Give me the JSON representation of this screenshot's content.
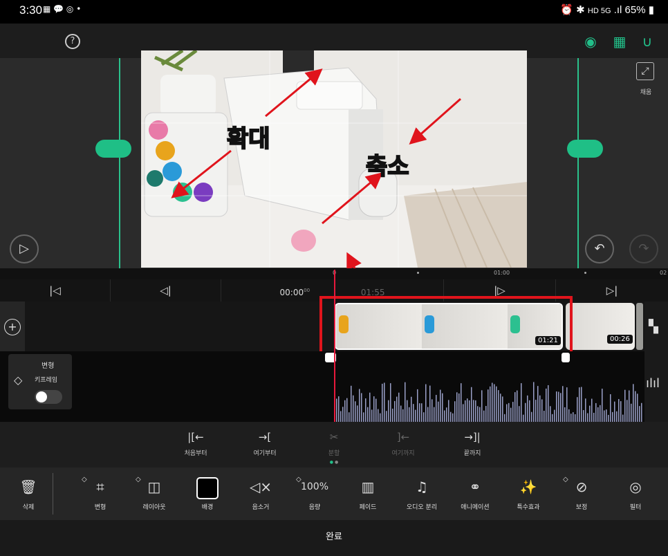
{
  "status": {
    "time": "3:30",
    "battery": "65%",
    "indicators": "HD 5G"
  },
  "topbar": {
    "help": "?"
  },
  "preview": {
    "fit_label": "채움",
    "overlay": {
      "zoom_in": "확대",
      "zoom_out": "축소"
    }
  },
  "ruler": {
    "start": "0",
    "mid": "01:00",
    "end": "02"
  },
  "transport": {
    "current": "00:00",
    "current_frames": "00",
    "total": "01:55"
  },
  "track": {
    "clip1_duration": "01:21",
    "clip2_duration": "00:26"
  },
  "keyframe_panel": {
    "title": "변형",
    "subtitle": "키프레임"
  },
  "trim": [
    {
      "label": "처음부터",
      "icon": "|[←",
      "dim": false
    },
    {
      "label": "여기부터",
      "icon": "→[",
      "dim": false
    },
    {
      "label": "분할",
      "icon": "✂",
      "dim": true
    },
    {
      "label": "여기까지",
      "icon": "]←",
      "dim": true
    },
    {
      "label": "끝까지",
      "icon": "→]|",
      "dim": false
    }
  ],
  "tools": {
    "delete": "삭제",
    "transform": "변형",
    "layout": "레이아웃",
    "background": "배경",
    "mute": "음소거",
    "volume": "음량",
    "volume_value": "100%",
    "fade": "페이드",
    "audio_split": "오디오 분리",
    "animation": "애니메이션",
    "effects": "특수효과",
    "correction": "보정",
    "filter": "필터"
  },
  "done": "완료",
  "colors": {
    "accent": "#22c08a",
    "playhead": "#e8193c",
    "highlight": "#e0141c",
    "caption_text": "#ffe600"
  }
}
